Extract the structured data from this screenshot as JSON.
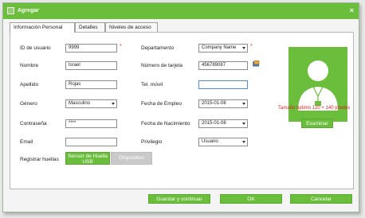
{
  "window": {
    "title": "Agregar",
    "close_glyph": "×"
  },
  "tabs": [
    {
      "label": "Información Personal"
    },
    {
      "label": "Detalles"
    },
    {
      "label": "Niveles de acceso"
    }
  ],
  "form": {
    "user_id": {
      "label": "ID de usuario",
      "value": "9999"
    },
    "name": {
      "label": "Nombre",
      "value": "Israel"
    },
    "lastname": {
      "label": "Apellido",
      "value": "Rojas"
    },
    "gender": {
      "label": "Género",
      "value": "Masculino"
    },
    "password": {
      "label": "Contraseña",
      "value": "****"
    },
    "email": {
      "label": "Email",
      "value": ""
    },
    "fingerprint": {
      "label": "Registrar huellas",
      "sensor_button_line1": "Sensor de Huella",
      "sensor_button_line2": "USB",
      "device_button": "Dispositivo"
    },
    "department": {
      "label": "Departamento",
      "value": "Company Name"
    },
    "card": {
      "label": "Número de tarjeta",
      "value": "456789087"
    },
    "mobile": {
      "label": "Tel. móvil",
      "value": ""
    },
    "hire_date": {
      "label": "Fecha de Empleo",
      "value": "2015-01-08"
    },
    "birth_date": {
      "label": "Fecha de Nacimiento",
      "value": "2015-01-08"
    },
    "privilege": {
      "label": "Privilegio",
      "value": "Usuario"
    },
    "required_mark": "*"
  },
  "photo": {
    "caption": "Tamaño óptimo 120 × 140 píxeles",
    "browse_button": "Examinar"
  },
  "footer": {
    "save_continue": "Guardar y continuar",
    "ok": "OK",
    "cancel": "Cancelar"
  },
  "colors": {
    "accent": "#6bbd3c",
    "required": "#e03030",
    "disabled": "#c9c9c9"
  }
}
